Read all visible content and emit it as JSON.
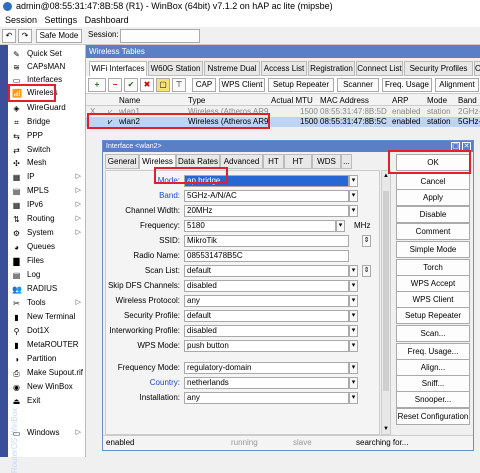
{
  "window": {
    "title": "admin@08:55:31:47:8B:58 (R1) - WinBox (64bit) v7.1.2 on hAP ac lite (mipsbe)"
  },
  "menu": [
    "Session",
    "Settings",
    "Dashboard"
  ],
  "toolbar": {
    "undo": "↶",
    "redo": "↷",
    "safe_mode": "Safe Mode",
    "session_label": "Session:"
  },
  "sidebar": {
    "vertical_label": "RouterOS WinBox",
    "items": [
      {
        "label": "Quick Set",
        "icon": "quickset-icon",
        "glyph": "✎"
      },
      {
        "label": "CAPsMAN",
        "icon": "capsman-icon",
        "glyph": "≋"
      },
      {
        "label": "Interfaces",
        "icon": "interfaces-icon",
        "glyph": "▭"
      },
      {
        "label": "Wireless",
        "icon": "wireless-icon",
        "glyph": "📶"
      },
      {
        "label": "WireGuard",
        "icon": "wireguard-icon",
        "glyph": "◈"
      },
      {
        "label": "Bridge",
        "icon": "bridge-icon",
        "glyph": "⌗"
      },
      {
        "label": "PPP",
        "icon": "ppp-icon",
        "glyph": "⇆"
      },
      {
        "label": "Switch",
        "icon": "switch-icon",
        "glyph": "⇄"
      },
      {
        "label": "Mesh",
        "icon": "mesh-icon",
        "glyph": "✣"
      },
      {
        "label": "IP",
        "icon": "ip-icon",
        "glyph": "▦",
        "arrow": true
      },
      {
        "label": "MPLS",
        "icon": "mpls-icon",
        "glyph": "▤",
        "arrow": true
      },
      {
        "label": "IPv6",
        "icon": "ipv6-icon",
        "glyph": "▦",
        "arrow": true
      },
      {
        "label": "Routing",
        "icon": "routing-icon",
        "glyph": "⇅",
        "arrow": true
      },
      {
        "label": "System",
        "icon": "system-icon",
        "glyph": "⚙",
        "arrow": true
      },
      {
        "label": "Queues",
        "icon": "queues-icon",
        "glyph": "◕"
      },
      {
        "label": "Files",
        "icon": "files-icon",
        "glyph": "▇"
      },
      {
        "label": "Log",
        "icon": "log-icon",
        "glyph": "▤"
      },
      {
        "label": "RADIUS",
        "icon": "radius-icon",
        "glyph": "👥"
      },
      {
        "label": "Tools",
        "icon": "tools-icon",
        "glyph": "✂",
        "arrow": true
      },
      {
        "label": "New Terminal",
        "icon": "terminal-icon",
        "glyph": "▮"
      },
      {
        "label": "Dot1X",
        "icon": "dot1x-icon",
        "glyph": "⚲"
      },
      {
        "label": "MetaROUTER",
        "icon": "metarouter-icon",
        "glyph": "▮"
      },
      {
        "label": "Partition",
        "icon": "partition-icon",
        "glyph": "◑"
      },
      {
        "label": "Make Supout.rif",
        "icon": "supout-icon",
        "glyph": "⎙"
      },
      {
        "label": "New WinBox",
        "icon": "winbox-icon",
        "glyph": "◉"
      },
      {
        "label": "Exit",
        "icon": "exit-icon",
        "glyph": "⏏"
      },
      {
        "label": "Windows",
        "icon": "windows-icon",
        "glyph": "▭",
        "arrow": true
      }
    ]
  },
  "panel": {
    "title": "Wireless Tables",
    "tabs": [
      "WiFi Interfaces",
      "W60G Station",
      "Nstreme Dual",
      "Access List",
      "Registration",
      "Connect List",
      "Security Profiles",
      "Channe"
    ],
    "toolbar": {
      "add": "+",
      "remove": "−",
      "enable": "✔",
      "disable": "✖",
      "comment": "▢",
      "filter": "⊤",
      "cap": "CAP",
      "wps_client": "WPS Client",
      "setup_repeater": "Setup Repeater",
      "scanner": "Scanner",
      "freq_usage": "Freq. Usage",
      "alignment": "Alignment"
    },
    "columns": [
      "Name",
      "Type",
      "Actual MTU",
      "MAC Address",
      "ARP",
      "Mode",
      "Band"
    ],
    "rows": [
      {
        "flag": "X",
        "name": "wlan1",
        "type": "Wireless (Atheros AR9...",
        "mtu": "1500",
        "mac": "08:55:31:47:8B:5D",
        "arp": "enabled",
        "mode": "station",
        "band": "2GHz-"
      },
      {
        "flag": "",
        "name": "wlan2",
        "type": "Wireless (Atheros AR9...",
        "mtu": "1500",
        "mac": "08:55:31:47:8B:5C",
        "arp": "enabled",
        "mode": "station",
        "band": "5GHz-"
      }
    ]
  },
  "dialog": {
    "title": "Interface <wlan2>",
    "tabs": [
      "General",
      "Wireless",
      "Data Rates",
      "Advanced",
      "HT",
      "HT MCS",
      "WDS",
      "..."
    ],
    "fields": [
      {
        "label": "Mode:",
        "value": "ap bridge",
        "blue": true,
        "dropdown": true,
        "selected": true
      },
      {
        "label": "Band:",
        "value": "5GHz-A/N/AC",
        "blue": true,
        "dropdown": true
      },
      {
        "label": "Channel Width:",
        "value": "20MHz",
        "dropdown": true
      },
      {
        "label": "Frequency:",
        "value": "5180",
        "dropdown": true,
        "unit": "MHz"
      },
      {
        "label": "SSID:",
        "value": "MikroTik",
        "updown": true
      },
      {
        "label": "Radio Name:",
        "value": "085531478B5C"
      },
      {
        "label": "Scan List:",
        "value": "default",
        "dropdown": true,
        "updown": true
      },
      {
        "label": "Skip DFS Channels:",
        "value": "disabled",
        "dropdown": true
      },
      {
        "label": "Wireless Protocol:",
        "value": "any",
        "dropdown": true
      },
      {
        "label": "Security Profile:",
        "value": "default",
        "dropdown": true
      },
      {
        "label": "Interworking Profile:",
        "value": "disabled",
        "dropdown": true
      },
      {
        "label": "WPS Mode:",
        "value": "push button",
        "dropdown": true
      },
      {
        "label": "Frequency Mode:",
        "value": "regulatory-domain",
        "dropdown": true
      },
      {
        "label": "Country:",
        "value": "netherlands",
        "blue": true,
        "dropdown": true
      },
      {
        "label": "Installation:",
        "value": "any",
        "dropdown": true
      }
    ],
    "buttons": [
      "OK",
      "Cancel",
      "Apply",
      "Disable",
      "Comment",
      "Simple Mode",
      "Torch",
      "WPS Accept",
      "WPS Client",
      "Setup Repeater",
      "Scan...",
      "Freq. Usage...",
      "Align...",
      "Sniff...",
      "Snooper...",
      "Reset Configuration"
    ],
    "status": [
      "enabled",
      "running",
      "slave",
      "searching for..."
    ]
  },
  "colors": {
    "accent": "#5b7fc7",
    "highlight": "#e0202a",
    "selected": "#2767d4"
  }
}
